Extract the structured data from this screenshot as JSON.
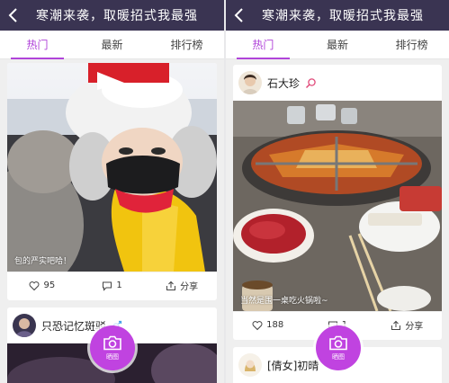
{
  "colors": {
    "titlebar": "#3a3452",
    "accent": "#b044d9",
    "fab": "#c043e0"
  },
  "left": {
    "title": "寒潮来袭，取暖招式我最强",
    "tabs": [
      "热门",
      "最新",
      "排行榜"
    ],
    "post1": {
      "caption": "包的严实吧哈！",
      "likes": "95",
      "comments": "1",
      "share": "分享"
    },
    "post2": {
      "username": "只恐记忆斑驳"
    },
    "fab_label": "晒图"
  },
  "right": {
    "title": "寒潮来袭，取暖招式我最强",
    "tabs": [
      "热门",
      "最新",
      "排行榜"
    ],
    "post1": {
      "username": "石大珍",
      "caption": "当然是围一桌吃火锅啦~",
      "likes": "188",
      "comments": "1",
      "share": "分享"
    },
    "post2": {
      "username": "[倩女]初晴"
    },
    "fab_label": "晒图"
  },
  "icons": {
    "back": "chevron-left-icon",
    "like": "heart-icon",
    "comment": "comment-icon",
    "share": "share-icon",
    "camera": "camera-icon",
    "search": "search-icon",
    "gender": "male-icon"
  }
}
